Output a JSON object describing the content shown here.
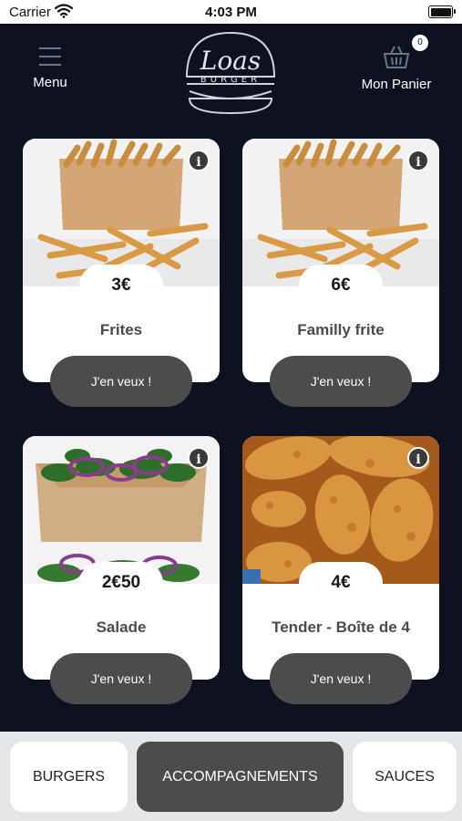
{
  "status_bar": {
    "carrier": "Carrier",
    "time": "4:03 PM"
  },
  "header": {
    "menu_label": "Menu",
    "logo_top": "Loas",
    "logo_bottom": "BURGER",
    "cart_label": "Mon Panier",
    "cart_count": "0"
  },
  "items": [
    {
      "price": "3€",
      "name": "Frites",
      "cta": "J'en veux !",
      "image": "fries-box"
    },
    {
      "price": "6€",
      "name": "Familly frite",
      "cta": "J'en veux !",
      "image": "fries-box"
    },
    {
      "price": "2€50",
      "name": "Salade",
      "cta": "J'en veux !",
      "image": "salad-box"
    },
    {
      "price": "4€",
      "name": "Tender - Boîte de 4",
      "cta": "J'en veux !",
      "image": "chicken-tenders"
    }
  ],
  "tabs": [
    {
      "label": "BURGERS",
      "active": false
    },
    {
      "label": "ACCOMPAGNEMENTS",
      "active": true
    },
    {
      "label": "SAUCES",
      "active": false
    }
  ],
  "colors": {
    "background": "#0d1120",
    "button": "#4c4c4c",
    "tab_bar": "#e5e6e8"
  }
}
